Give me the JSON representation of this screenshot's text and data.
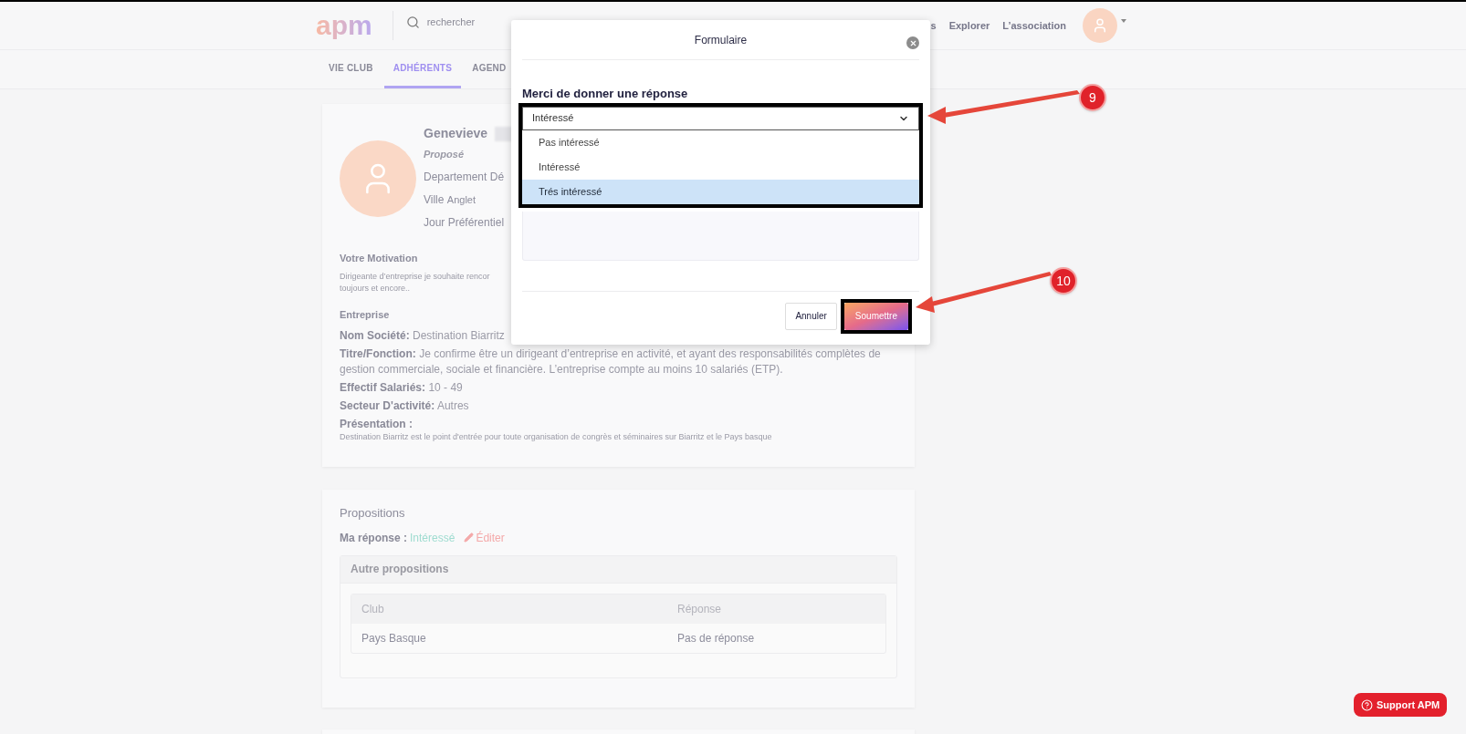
{
  "header": {
    "logo": "apm",
    "search": {
      "placeholder": "rechercher"
    },
    "nav": [
      "s",
      "Explorer",
      "L’association"
    ]
  },
  "tabs": [
    {
      "label": "VIE CLUB",
      "selected": false
    },
    {
      "label": "ADHÉRENTS",
      "selected": true
    },
    {
      "label": "AGEND",
      "selected": false
    }
  ],
  "profile": {
    "name": "Genevieve",
    "status": "Proposé",
    "lines": [
      {
        "label": "Departement",
        "value": "Dé"
      },
      {
        "label": "Ville",
        "value": "Anglet"
      },
      {
        "label": "Jour Préférentiel"
      }
    ]
  },
  "motivation": {
    "title": "Votre Motivation",
    "lines": [
      "Dirigeante d’entreprise je souhaite rencor",
      "toujours et encore.."
    ]
  },
  "company": {
    "title": "Entreprise",
    "facts": [
      {
        "label": "Nom Société:",
        "value": "Destination Biarritz"
      },
      {
        "label": "Titre/Fonction:",
        "value": "Je confirme être un dirigeant d’entreprise en activité, et ayant des responsabilités complètes de gestion commerciale, sociale et financière. L’entreprise compte au moins 10 salariés (ETP)."
      },
      {
        "label": "Effectif Salariés:",
        "value": "10 - 49"
      },
      {
        "label": "Secteur D'activité:",
        "value": "Autres"
      }
    ],
    "presentation": {
      "label": "Présentation :",
      "text": "Destination Biarritz est le point d'entrée pour toute organisation de congrès et séminaires sur Biarritz et le Pays basque"
    }
  },
  "propositions": {
    "title": "Propositions",
    "answer_label": "Ma réponse :",
    "answer": "Intéressé",
    "edit": "Éditer",
    "panel": {
      "title": "Autre propositions",
      "columns": [
        "Club",
        "Réponse"
      ],
      "rows": [
        [
          "Pays Basque",
          "Pas de réponse"
        ]
      ]
    }
  },
  "modal": {
    "title": "Formulaire",
    "question": "Merci de donner une réponse",
    "select": {
      "value": "Intéressé",
      "options": [
        {
          "label": "Pas intéressé",
          "highlighted": false
        },
        {
          "label": "Intéressé",
          "highlighted": false
        },
        {
          "label": "Trés intéressé",
          "highlighted": true
        }
      ]
    },
    "buttons": [
      {
        "label": "Annuler",
        "kind": "secondary"
      },
      {
        "label": "Soumettre",
        "kind": "primary"
      }
    ]
  },
  "annotations": [
    {
      "number": "9"
    },
    {
      "number": "10"
    }
  ],
  "support_button": "Support APM"
}
